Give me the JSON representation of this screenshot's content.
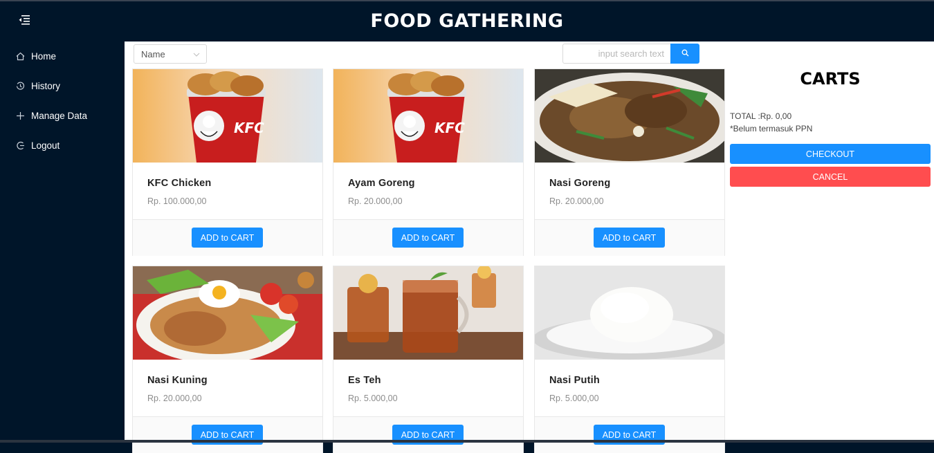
{
  "header": {
    "title": "FOOD GATHERING"
  },
  "sidebar": {
    "items": [
      {
        "label": "Home",
        "icon": "home-icon"
      },
      {
        "label": "History",
        "icon": "history-icon"
      },
      {
        "label": "Manage Data",
        "icon": "plus-icon"
      },
      {
        "label": "Logout",
        "icon": "logout-icon"
      }
    ]
  },
  "toolbar": {
    "sort_value": "Name",
    "search_placeholder": "input search text"
  },
  "products": [
    {
      "name": "KFC Chicken",
      "price": "Rp. 100.000,00",
      "button": "ADD to CART"
    },
    {
      "name": "Ayam Goreng",
      "price": "Rp. 20.000,00",
      "button": "ADD to CART"
    },
    {
      "name": "Nasi Goreng",
      "price": "Rp. 20.000,00",
      "button": "ADD to CART"
    },
    {
      "name": "Nasi Kuning",
      "price": "Rp. 20.000,00",
      "button": "ADD to CART"
    },
    {
      "name": "Es Teh",
      "price": "Rp. 5.000,00",
      "button": "ADD to CART"
    },
    {
      "name": "Nasi Putih",
      "price": "Rp. 5.000,00",
      "button": "ADD to CART"
    }
  ],
  "cart": {
    "title": "CARTS",
    "total": "TOTAL :Rp. 0,00",
    "note": "*Belum termasuk PPN",
    "checkout_label": "CHECKOUT",
    "cancel_label": "CANCEL"
  },
  "colors": {
    "sidebar_bg": "#001529",
    "primary": "#1890ff",
    "danger": "#ff4d4f"
  }
}
